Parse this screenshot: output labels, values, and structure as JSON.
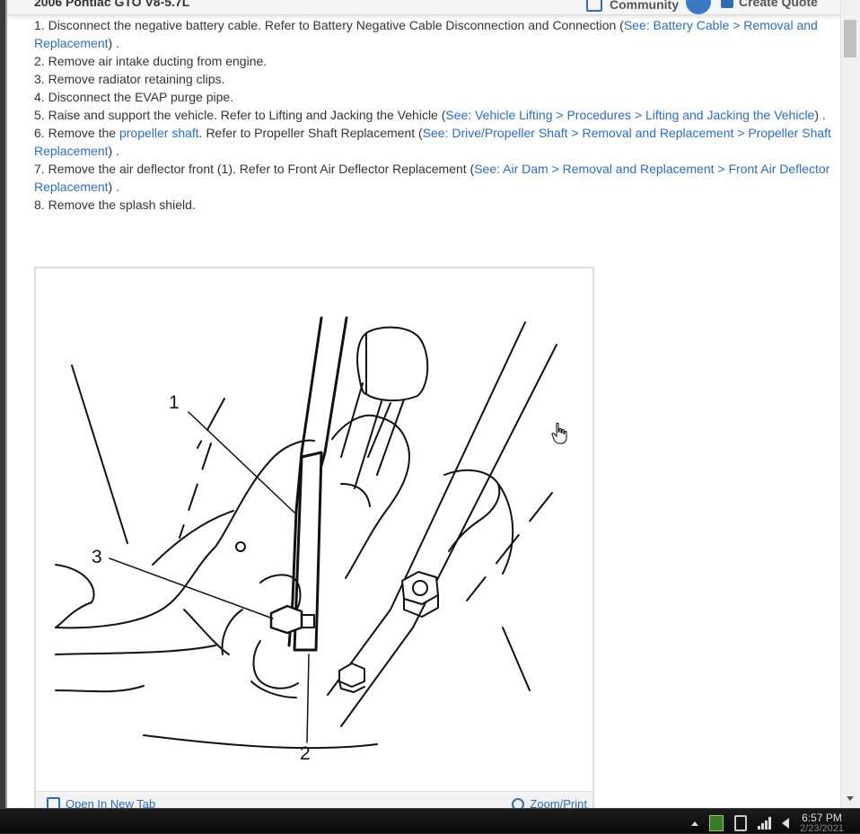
{
  "header": {
    "title": "2006 Pontiac GTO V8-5.7L",
    "community_label": "Community",
    "create_quote_label": "Create Quote"
  },
  "steps": [
    {
      "num": "1.",
      "text": "Disconnect the negative battery cable. Refer to Battery Negative Cable Disconnection and Connection (",
      "link": "See: Battery Cable > Removal and Replacement",
      "after": ") ."
    },
    {
      "num": "2.",
      "text": "Remove air intake ducting from engine."
    },
    {
      "num": "3.",
      "text": "Remove radiator retaining clips."
    },
    {
      "num": "4.",
      "text": "Disconnect the EVAP purge pipe."
    },
    {
      "num": "5.",
      "text": "Raise and support the vehicle. Refer to Lifting and Jacking the Vehicle (",
      "link": "See: Vehicle Lifting > Procedures > Lifting and Jacking the Vehicle",
      "after": ") ."
    },
    {
      "num": "6.",
      "pre": "Remove the ",
      "pre_link": "propeller shaft",
      "text": ". Refer to Propeller Shaft Replacement (",
      "link": "See: Drive/Propeller Shaft > Removal and Replacement > Propeller Shaft Replacement",
      "after": ") ."
    },
    {
      "num": "7.",
      "text": "Remove the air deflector front (1). Refer to Front Air Deflector Replacement (",
      "link": "See: Air Dam > Removal and Replacement > Front Air Deflector Replacement",
      "after": ") ."
    },
    {
      "num": "8.",
      "text": "Remove the splash shield."
    }
  ],
  "figure": {
    "callouts": [
      "1",
      "2",
      "3"
    ],
    "open_new_tab_label": "Open In New Tab",
    "zoom_print_label": "Zoom/Print"
  },
  "taskbar": {
    "time": "6:57 PM",
    "date": "2/23/2021"
  },
  "colors": {
    "link": "#2f6cb5",
    "text": "#333333",
    "taskbar": "#111111"
  }
}
